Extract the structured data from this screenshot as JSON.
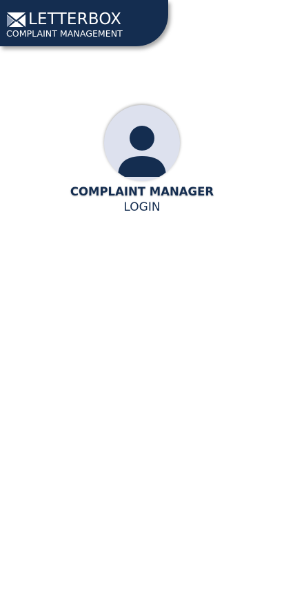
{
  "brand": {
    "name": "LETTERBOX",
    "tagline": "COMPLAINT MANAGEMENT",
    "logo_icon": "envelope-icon",
    "color": "#142d50"
  },
  "login": {
    "avatar_icon": "user-icon",
    "role_title": "COMPLAINT MANAGER",
    "action_label": "LOGIN",
    "avatar_bg": "#dde1ee"
  }
}
